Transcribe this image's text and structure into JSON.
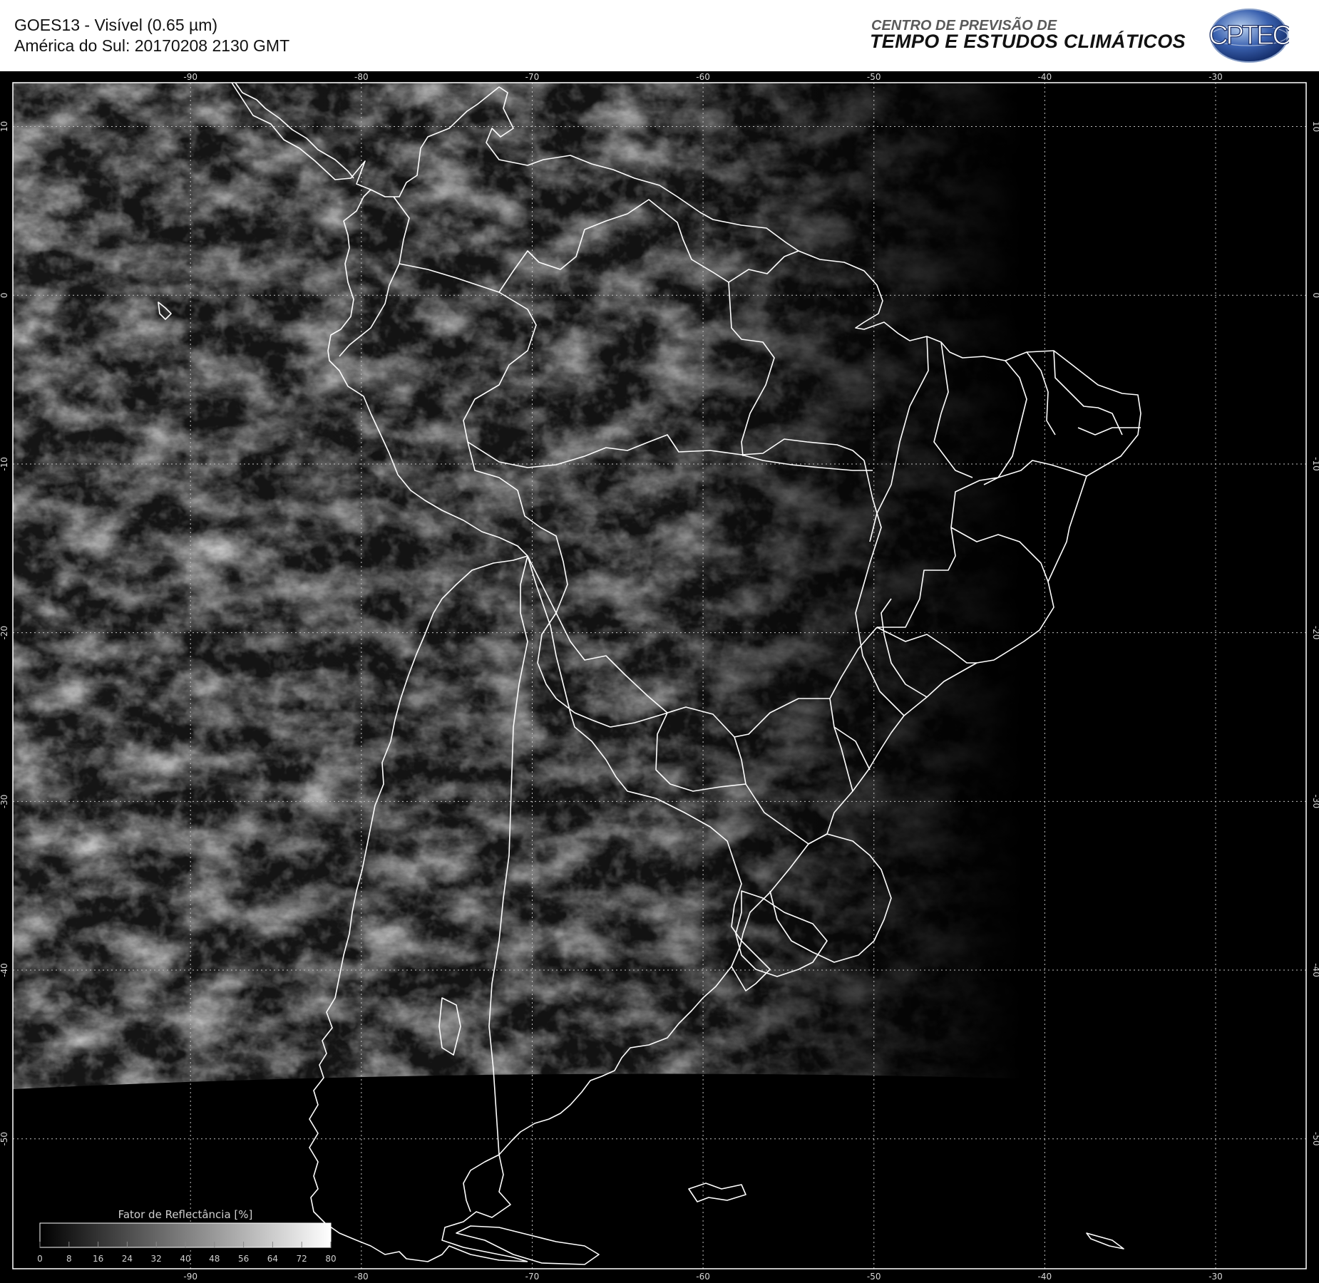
{
  "header": {
    "title_line1": "GOES13 - Visível (0.65 µm)",
    "title_line2": "América do Sul: 20170208 2130 GMT",
    "org_line1": "CENTRO DE PREVISÃO DE",
    "org_line2": "TEMPO E ESTUDOS CLIMÁTICOS",
    "logo_text": "CPTEC"
  },
  "map": {
    "satellite": "GOES13",
    "channel": "Visível (0.65 µm)",
    "region": "América do Sul",
    "datetime": "20170208 2130 GMT",
    "lon_ticks": [
      "-90",
      "-80",
      "-70",
      "-60",
      "-50",
      "-40",
      "-30"
    ],
    "lat_ticks": [
      "10",
      "0",
      "-10",
      "-20",
      "-30",
      "-40",
      "-50"
    ],
    "lon_values": [
      -90,
      -80,
      -70,
      -60,
      -50,
      -40,
      -30
    ],
    "lat_values": [
      10,
      0,
      -10,
      -20,
      -30,
      -40,
      -50
    ],
    "extent": {
      "lon_min": -100.4,
      "lon_max": -24.7,
      "lat_min": -57.7,
      "lat_max": 12.6
    }
  },
  "legend": {
    "title": "Fator de Reflectância [%]",
    "ticks": [
      "0",
      "8",
      "16",
      "24",
      "32",
      "40",
      "48",
      "56",
      "64",
      "72",
      "80"
    ],
    "min": 0,
    "max": 80
  },
  "colors": {
    "background": "#000000",
    "coastline": "#ffffff",
    "grid": "#bfbfbf",
    "text": "#111111",
    "logo_blue": "#1f3f8a"
  }
}
